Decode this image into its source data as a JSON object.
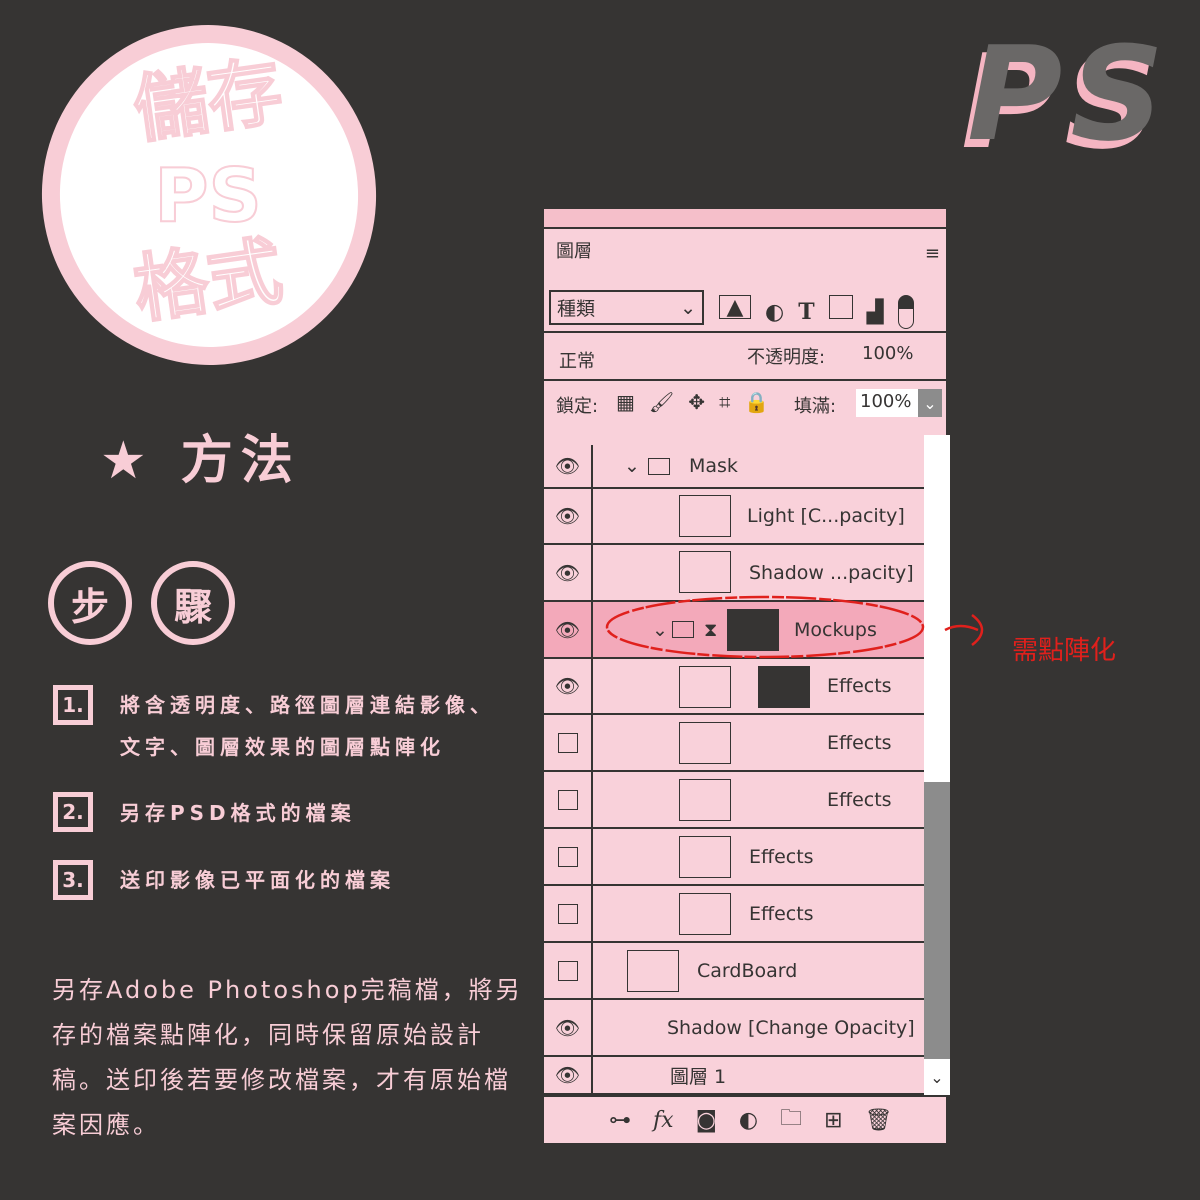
{
  "title": {
    "line1": "儲存",
    "line2": "PS",
    "line3": "格式"
  },
  "logo": "PS",
  "method": {
    "star": "★",
    "label": "方法"
  },
  "steps_badge": [
    "步",
    "驟"
  ],
  "steps": [
    {
      "num": "1.",
      "text1": "將含透明度、路徑圖層連結影像、",
      "text2": "文字、圖層效果的圖層點陣化"
    },
    {
      "num": "2.",
      "text1": "另存PSD格式的檔案"
    },
    {
      "num": "3.",
      "text1": "送印影像已平面化的檔案"
    }
  ],
  "paragraph": "另存Adobe Photoshop完稿檔，將另存的檔案點陣化，同時保留原始設計稿。送印後若要修改檔案，才有原始檔案因應。",
  "annotation": {
    "text": "需點陣化",
    "color": "#e0201c"
  },
  "panel": {
    "title": "圖層",
    "filter": "種類",
    "blend": "正常",
    "opacity_label": "不透明度:",
    "opacity": "100%",
    "lock_label": "鎖定:",
    "fill_label": "填滿:",
    "fill": "100%",
    "layers": [
      {
        "name": "Mask",
        "visible": true,
        "type": "group"
      },
      {
        "name": "Light [C...pacity]",
        "visible": true
      },
      {
        "name": "Shadow ...pacity]",
        "visible": true
      },
      {
        "name": "Mockups",
        "visible": true,
        "type": "group",
        "selected": true
      },
      {
        "name": "Effects",
        "visible": true
      },
      {
        "name": "Effects",
        "visible": false
      },
      {
        "name": "Effects",
        "visible": false
      },
      {
        "name": "Effects",
        "visible": false
      },
      {
        "name": "Effects",
        "visible": false
      },
      {
        "name": "CardBoard",
        "visible": false
      },
      {
        "name": "Shadow [Change Opacity]",
        "visible": true
      },
      {
        "name": "圖層 1",
        "visible": true
      }
    ],
    "colors": {
      "panel": "#f9d1da",
      "selected": "#f3a9ba",
      "header": "#f5bfca"
    }
  }
}
